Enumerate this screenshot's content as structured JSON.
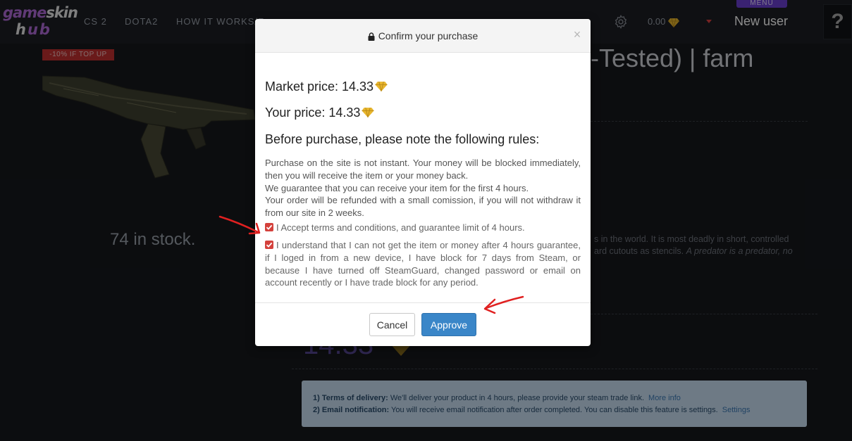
{
  "navbar": {
    "logo_top_a": "game",
    "logo_top_b": "skin",
    "logo_bottom_a": "h",
    "logo_bottom_b": "ub",
    "links": [
      "CS 2",
      "DOTA2",
      "HOW IT WORKS/F"
    ],
    "balance": "0.00",
    "menu_label": "MENU",
    "user_name": "New user",
    "help_label": "?"
  },
  "product": {
    "promo_badge": "-10% IF TOP UP",
    "title_fragment": "-Tested) | farm",
    "stock": "74 in stock.",
    "description_line1": "s in the world. It is most deadly in short, controlled",
    "description_line2_plain": "ard cutouts as stencils. ",
    "description_line2_italic": "A predator is a predator, no",
    "price_fragment": "14.33"
  },
  "delivery": {
    "terms_label": "1) Terms of delivery:",
    "terms_text": " We'll deliver your product in 4 hours, please provide your steam trade link.",
    "terms_link": "More info",
    "email_label": "2) Email notification:",
    "email_text": " You will receive email notification after order completed. You can disable this feature is settings.",
    "email_link": "Settings"
  },
  "modal": {
    "title": "Confirm your purchase",
    "close_label": "×",
    "market_price_label": "Market price: 14.33",
    "your_price_label": "Your price: 14.33",
    "rules_heading": "Before purchase, please note the following rules:",
    "rules": [
      "Purchase on the site is not instant. Your money will be blocked immediately, then you will receive the item or your money back.",
      "We guarantee that you can receive your item for the first 4 hours.",
      "Your order will be refunded with a small comission, if you will not withdraw it from our site in 2 weeks."
    ],
    "checkbox_terms": "I Accept terms and conditions, and guarantee limit of 4 hours.",
    "checkbox_guarantee": "I understand that I can not get the item or money after 4 hours guarantee, if I loged in from a new device, I have block for 7 days from Steam, or because I have turned off SteamGuard, changed password or email on account recently or I have trade block for any period.",
    "checkbox_terms_checked": true,
    "checkbox_guarantee_checked": true,
    "cancel_label": "Cancel",
    "approve_label": "Approve"
  },
  "colors": {
    "approve": "#3a86c8",
    "checkbox": "#d4413c",
    "gem": "#e8b62c",
    "annotation_arrow": "#e02020"
  },
  "icons": [
    "lock-icon",
    "close-icon",
    "gear-icon",
    "diamond-icon",
    "checkmark-icon",
    "chevron-down-icon",
    "question-icon"
  ]
}
